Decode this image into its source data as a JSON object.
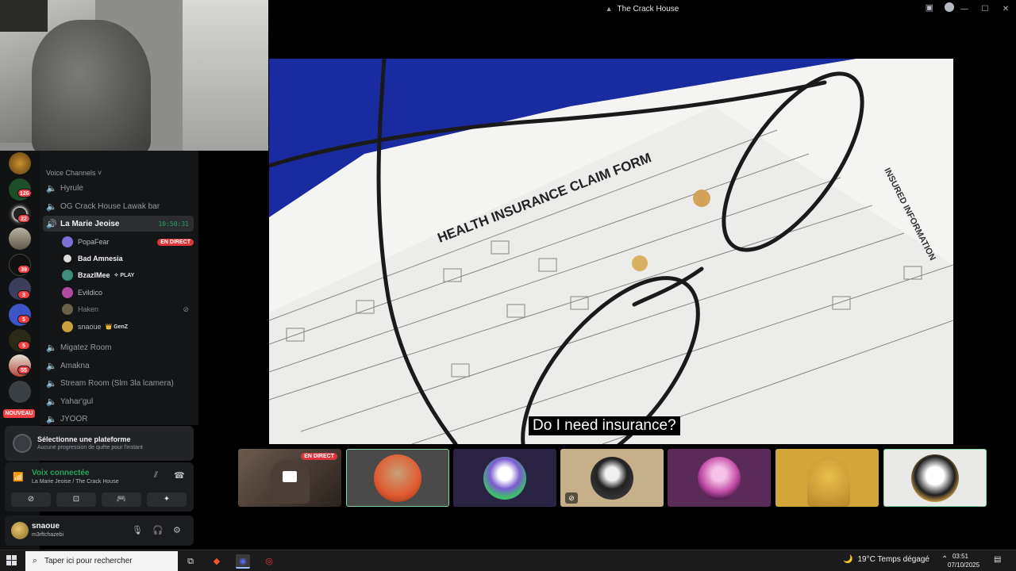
{
  "window": {
    "title": "The Crack House"
  },
  "channels": {
    "section_header": "Voice Channels ˅",
    "voice": [
      {
        "name": "Hyrule"
      },
      {
        "name": "OG Crack House Lawak bar"
      },
      {
        "name": "La Marie Jeoise",
        "timer": "10:50:31"
      },
      {
        "name": "Migatez Room"
      },
      {
        "name": "Amakna"
      },
      {
        "name": "Stream Room (Slm 3la lcamera)"
      },
      {
        "name": "Yahar'gul"
      },
      {
        "name": "JYOOR"
      }
    ],
    "members": [
      {
        "name": "PopaFear",
        "tag": "EN DIRECT"
      },
      {
        "name": "Bad Amnesia"
      },
      {
        "name": "BzazlMee",
        "tag": "✧ PLAY"
      },
      {
        "name": "Evildico"
      },
      {
        "name": "Haken"
      },
      {
        "name": "snaoue",
        "tag": "👑 GenZ"
      }
    ]
  },
  "servers": {
    "badges": [
      "126",
      "22",
      "39",
      "3",
      "5",
      "5",
      "55"
    ],
    "new_label": "NOUVEAU"
  },
  "quest": {
    "title": "Sélectionne une plateforme",
    "subtitle": "Aucune progression de quête pour l'instant"
  },
  "voice_status": {
    "title": "Voix connectée",
    "location": "La Marie Jeoise / The Crack House"
  },
  "user": {
    "name": "snaoue",
    "status": "m3rftchazebi"
  },
  "stream": {
    "subtitle": "Do I need insurance?",
    "form_title": "HEALTH INSURANCE CLAIM FORM",
    "side_label": "INSURED INFORMATION"
  },
  "tiles": {
    "live_label": "EN DIRECT"
  },
  "taskbar": {
    "search_placeholder": "Taper ici pour rechercher",
    "weather": "19°C  Temps dégagé",
    "time": "03:51",
    "date": "07/10/2025"
  },
  "colors": {
    "accent_green": "#23a55a",
    "live_red": "#da373c",
    "stream_blue": "#1a2aa0"
  }
}
